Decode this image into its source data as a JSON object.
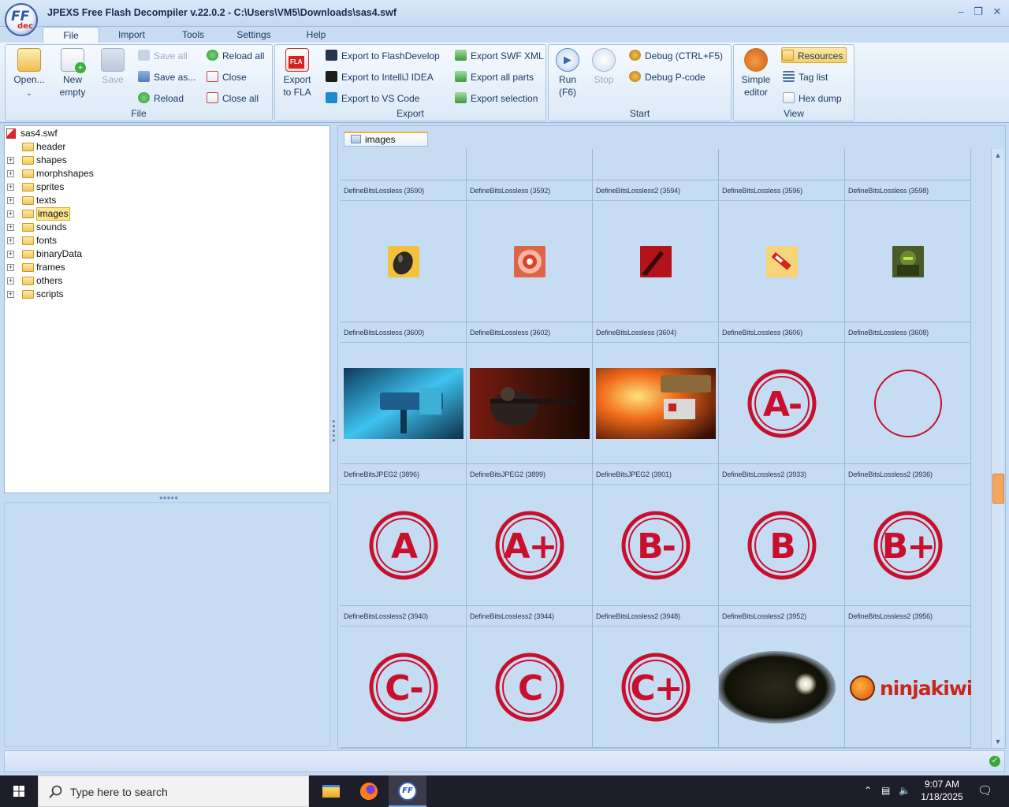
{
  "window": {
    "title": "JPEXS Free Flash Decompiler v.22.0.2 - C:\\Users\\VM5\\Downloads\\sas4.swf",
    "logo_ff": "FF",
    "logo_dec": "dec"
  },
  "menu_tabs": [
    "File",
    "Import",
    "Tools",
    "Settings",
    "Help"
  ],
  "ribbon": {
    "file": {
      "label": "File",
      "open": "Open...",
      "new_line1": "New",
      "new_line2": "empty",
      "save": "Save",
      "save_all": "Save all",
      "save_as": "Save as...",
      "reload": "Reload",
      "reload_all": "Reload all",
      "close": "Close",
      "close_all": "Close all"
    },
    "export": {
      "label": "Export",
      "fla_badge": "FLA",
      "export_fla_line1": "Export",
      "export_fla_line2": "to FLA",
      "to_flashdevelop": "Export to FlashDevelop",
      "to_intellij": "Export to IntelliJ IDEA",
      "to_vscode": "Export to VS Code",
      "swf_xml": "Export SWF XML",
      "all_parts": "Export all parts",
      "selection": "Export selection"
    },
    "start": {
      "label": "Start",
      "run_line1": "Run",
      "run_line2": "(F6)",
      "stop": "Stop",
      "debug": "Debug (CTRL+F5)",
      "debug_pcode": "Debug P-code"
    },
    "view": {
      "label": "View",
      "simple_line1": "Simple",
      "simple_line2": "editor",
      "resources": "Resources",
      "tag_list": "Tag list",
      "hex_dump": "Hex dump"
    }
  },
  "tree": {
    "root": "sas4.swf",
    "items": [
      {
        "label": "header",
        "expandable": false
      },
      {
        "label": "shapes",
        "expandable": true
      },
      {
        "label": "morphshapes",
        "expandable": true
      },
      {
        "label": "sprites",
        "expandable": true
      },
      {
        "label": "texts",
        "expandable": true
      },
      {
        "label": "images",
        "expandable": true,
        "selected": true
      },
      {
        "label": "sounds",
        "expandable": true
      },
      {
        "label": "fonts",
        "expandable": true
      },
      {
        "label": "binaryData",
        "expandable": true
      },
      {
        "label": "frames",
        "expandable": true
      },
      {
        "label": "others",
        "expandable": true
      },
      {
        "label": "scripts",
        "expandable": true
      }
    ]
  },
  "content": {
    "tab": "images",
    "top_row_labels": [
      "",
      "",
      "",
      "",
      ""
    ],
    "rows": [
      [
        {
          "label": "DefineBitsLossless (3590)",
          "img": "bomb-icon"
        },
        {
          "label": "DefineBitsLossless (3592)",
          "img": "burst-icon"
        },
        {
          "label": "DefineBitsLossless2 (3594)",
          "img": "red-cut-icon"
        },
        {
          "label": "DefineBitsLossless (3596)",
          "img": "syringe-icon"
        },
        {
          "label": "DefineBitsLossless (3598)",
          "img": "soldier-icon"
        }
      ],
      [
        {
          "label": "DefineBitsLossless (3600)",
          "img": "blue-weapon-art"
        },
        {
          "label": "DefineBitsLossless (3602)",
          "img": "sniper-art"
        },
        {
          "label": "DefineBitsLossless (3604)",
          "img": "turret-fire-art"
        },
        {
          "label": "DefineBitsLossless (3606)",
          "img": "grade-badge",
          "grade": "A-"
        },
        {
          "label": "DefineBitsLossless (3608)",
          "img": "empty-ring",
          "grade": ""
        }
      ],
      [
        {
          "label": "DefineBitsJPEG2 (3896)",
          "img": "grade-badge",
          "grade": "A"
        },
        {
          "label": "DefineBitsJPEG2 (3899)",
          "img": "grade-badge",
          "grade": "A+"
        },
        {
          "label": "DefineBitsJPEG2 (3901)",
          "img": "grade-badge",
          "grade": "B-"
        },
        {
          "label": "DefineBitsLossless2 (3933)",
          "img": "grade-badge",
          "grade": "B"
        },
        {
          "label": "DefineBitsLossless2 (3936)",
          "img": "grade-badge",
          "grade": "B+"
        }
      ],
      [
        {
          "label": "DefineBitsLossless2 (3940)",
          "img": "grade-badge",
          "grade": "C-"
        },
        {
          "label": "DefineBitsLossless2 (3944)",
          "img": "grade-badge",
          "grade": "C"
        },
        {
          "label": "DefineBitsLossless2 (3948)",
          "img": "grade-badge",
          "grade": "C+"
        },
        {
          "label": "DefineBitsLossless2 (3952)",
          "img": "dark-smoke-art"
        },
        {
          "label": "DefineBitsLossless2 (3956)",
          "img": "ninjakiwi-logo",
          "logo_text": "ninjakiwi"
        }
      ]
    ]
  },
  "taskbar": {
    "search_placeholder": "Type here to search",
    "time": "9:07 AM",
    "date": "1/18/2025"
  },
  "colors": {
    "grade_red": "#c8102e",
    "panel_blue": "#c6dcf2",
    "selection_yellow": "#fde58d"
  }
}
